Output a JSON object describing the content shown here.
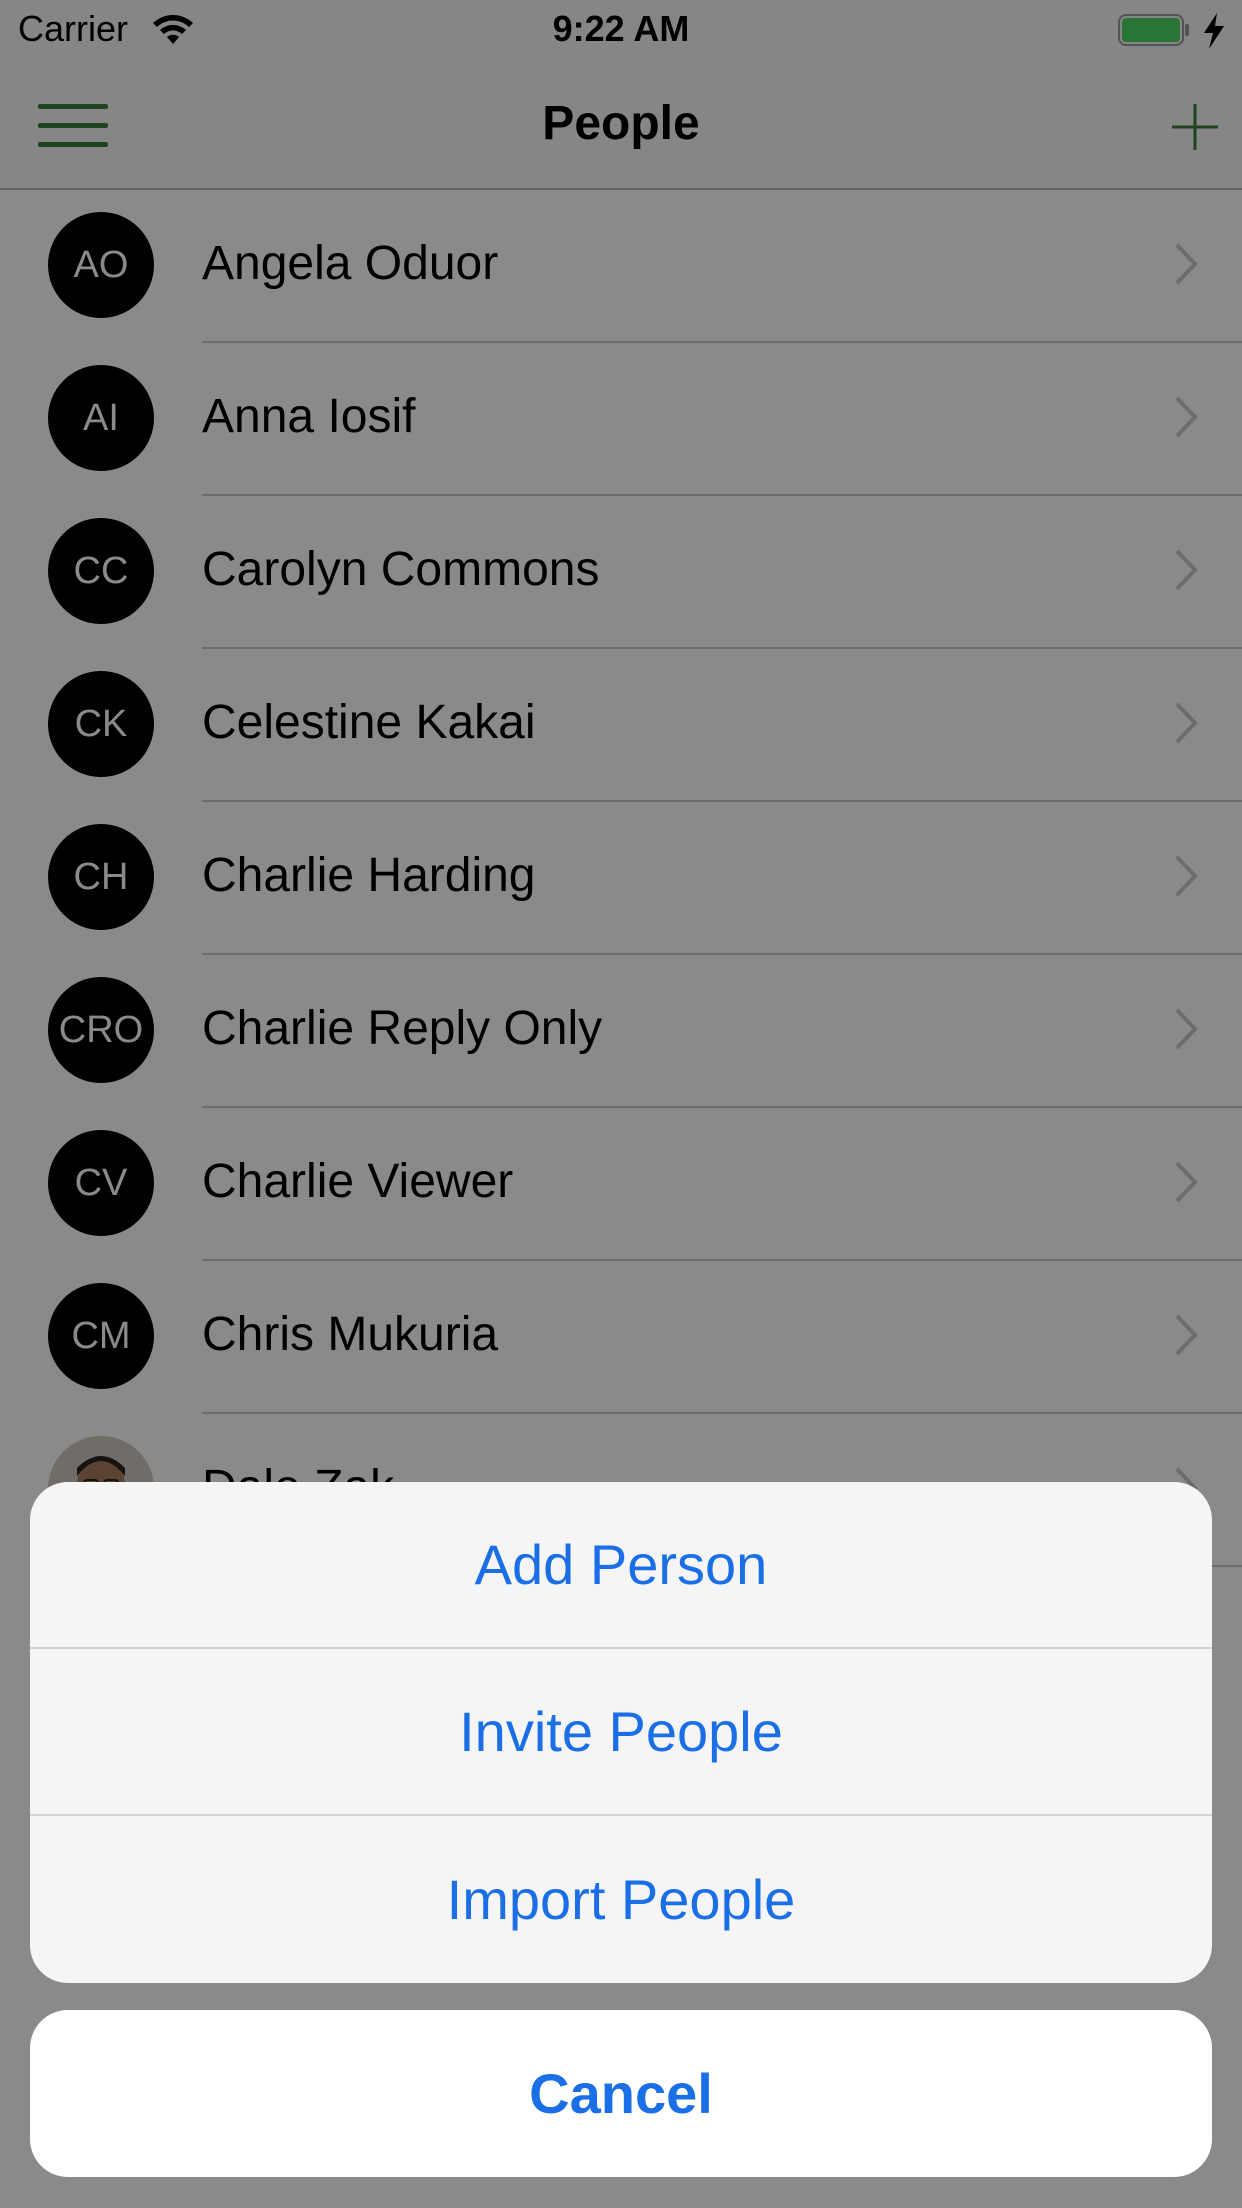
{
  "status_bar": {
    "carrier": "Carrier",
    "time": "9:22 AM"
  },
  "nav": {
    "title": "People",
    "menu_icon": "hamburger-menu-icon",
    "add_icon": "plus-icon",
    "accent_color": "#3a7d3a"
  },
  "people": [
    {
      "initials": "AO",
      "name": "Angela Oduor"
    },
    {
      "initials": "AI",
      "name": "Anna Iosif"
    },
    {
      "initials": "CC",
      "name": "Carolyn Commons"
    },
    {
      "initials": "CK",
      "name": "Celestine Kakai"
    },
    {
      "initials": "CH",
      "name": "Charlie Harding"
    },
    {
      "initials": "CRO",
      "name": "Charlie Reply Only"
    },
    {
      "initials": "CV",
      "name": "Charlie Viewer"
    },
    {
      "initials": "CM",
      "name": "Chris Mukuria"
    },
    {
      "initials": "",
      "name": "Dale Zak",
      "avatar": "photo"
    }
  ],
  "action_sheet": {
    "actions": [
      "Add Person",
      "Invite People",
      "Import People"
    ],
    "cancel": "Cancel",
    "action_color": "#1a6fe6"
  }
}
